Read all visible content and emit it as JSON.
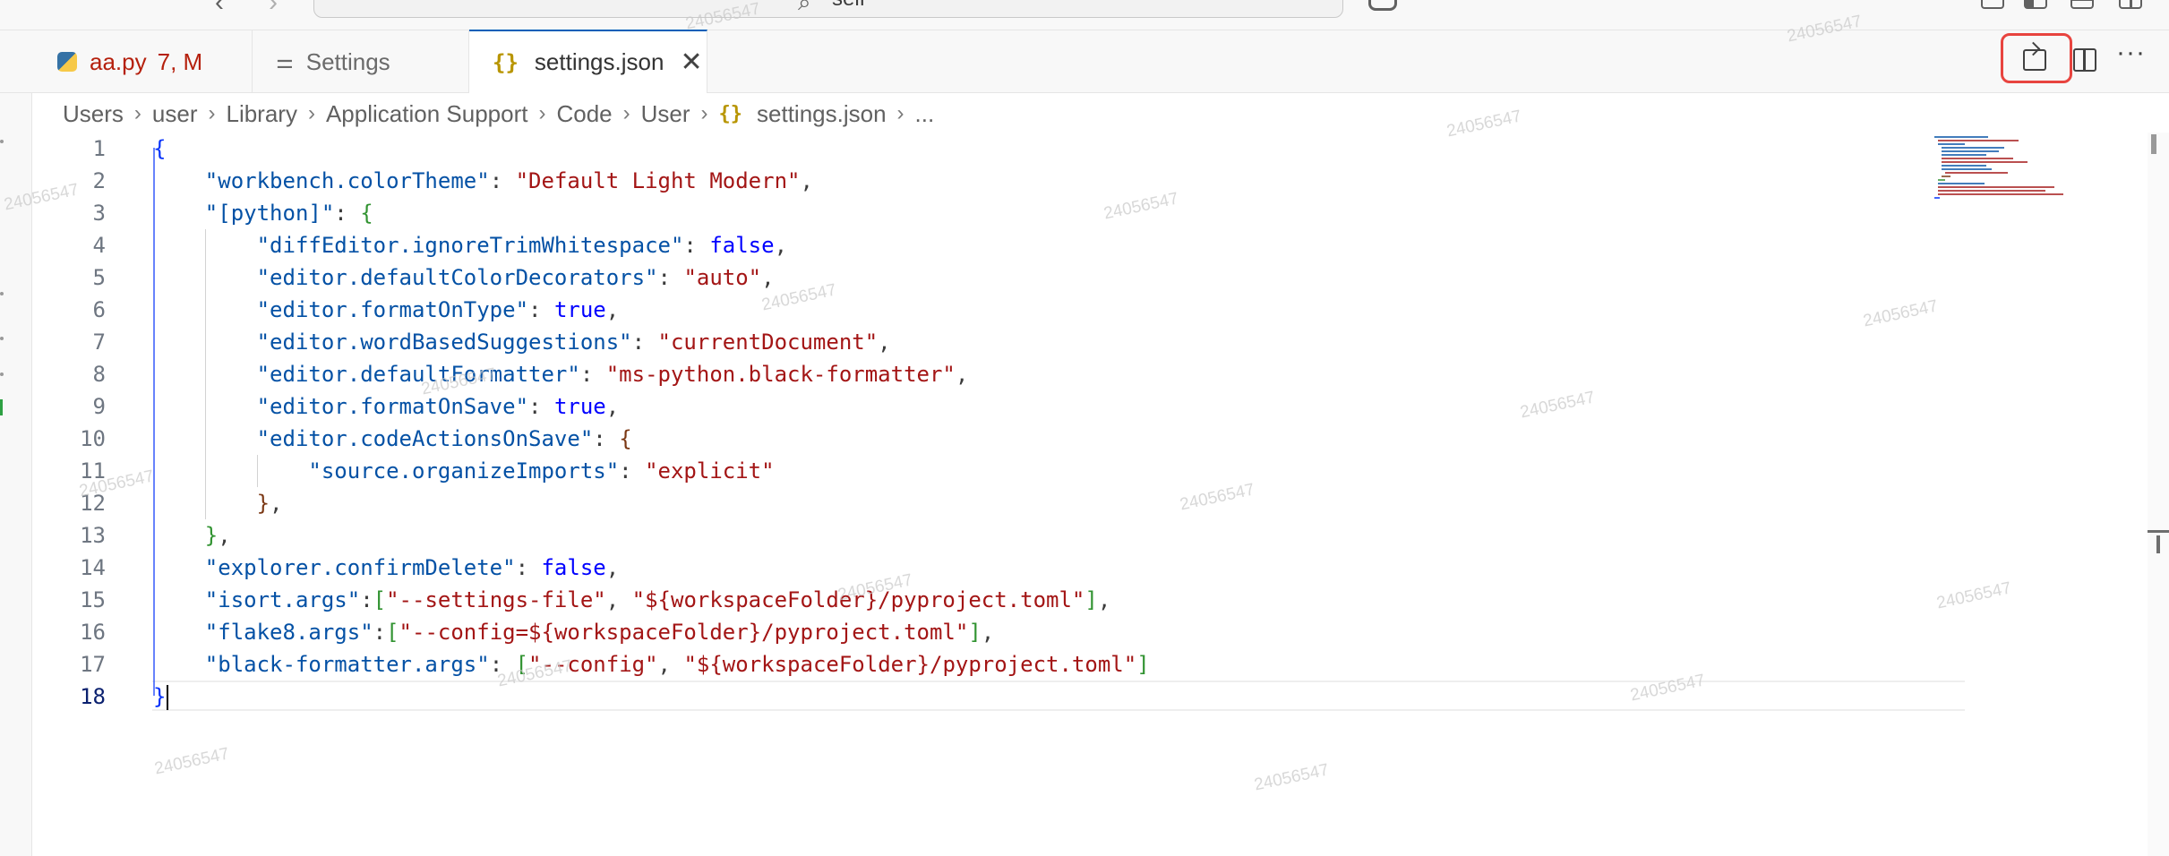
{
  "titlebar": {
    "search_text": "self"
  },
  "tabs": [
    {
      "name": "aa.py",
      "badge": "7, M"
    },
    {
      "name": "Settings"
    },
    {
      "name": "settings.json",
      "close": "✕"
    }
  ],
  "editor_actions": {
    "more": "···"
  },
  "breadcrumb": [
    "Users",
    "user",
    "Library",
    "Application Support",
    "Code",
    "User",
    "settings.json",
    "..."
  ],
  "editor": {
    "line_numbers": [
      "1",
      "2",
      "3",
      "4",
      "5",
      "6",
      "7",
      "8",
      "9",
      "10",
      "11",
      "12",
      "13",
      "14",
      "15",
      "16",
      "17",
      "18"
    ],
    "current_line": "18",
    "lines": [
      [
        [
          "br1",
          "{"
        ]
      ],
      [
        [
          "p",
          "    "
        ],
        [
          "k",
          "\"workbench.colorTheme\""
        ],
        [
          "p",
          ": "
        ],
        [
          "s",
          "\"Default Light Modern\""
        ],
        [
          "p",
          ","
        ]
      ],
      [
        [
          "p",
          "    "
        ],
        [
          "k",
          "\"[python]\""
        ],
        [
          "p",
          ": "
        ],
        [
          "br2",
          "{"
        ]
      ],
      [
        [
          "p",
          "        "
        ],
        [
          "k",
          "\"diffEditor.ignoreTrimWhitespace\""
        ],
        [
          "p",
          ": "
        ],
        [
          "b",
          "false"
        ],
        [
          "p",
          ","
        ]
      ],
      [
        [
          "p",
          "        "
        ],
        [
          "k",
          "\"editor.defaultColorDecorators\""
        ],
        [
          "p",
          ": "
        ],
        [
          "s",
          "\"auto\""
        ],
        [
          "p",
          ","
        ]
      ],
      [
        [
          "p",
          "        "
        ],
        [
          "k",
          "\"editor.formatOnType\""
        ],
        [
          "p",
          ": "
        ],
        [
          "b",
          "true"
        ],
        [
          "p",
          ","
        ]
      ],
      [
        [
          "p",
          "        "
        ],
        [
          "k",
          "\"editor.wordBasedSuggestions\""
        ],
        [
          "p",
          ": "
        ],
        [
          "s",
          "\"currentDocument\""
        ],
        [
          "p",
          ","
        ]
      ],
      [
        [
          "p",
          "        "
        ],
        [
          "k",
          "\"editor.defaultFormatter\""
        ],
        [
          "p",
          ": "
        ],
        [
          "s",
          "\"ms-python.black-formatter\""
        ],
        [
          "p",
          ","
        ]
      ],
      [
        [
          "p",
          "        "
        ],
        [
          "k",
          "\"editor.formatOnSave\""
        ],
        [
          "p",
          ": "
        ],
        [
          "b",
          "true"
        ],
        [
          "p",
          ","
        ]
      ],
      [
        [
          "p",
          "        "
        ],
        [
          "k",
          "\"editor.codeActionsOnSave\""
        ],
        [
          "p",
          ": "
        ],
        [
          "br3",
          "{"
        ]
      ],
      [
        [
          "p",
          "            "
        ],
        [
          "k",
          "\"source.organizeImports\""
        ],
        [
          "p",
          ": "
        ],
        [
          "s",
          "\"explicit\""
        ]
      ],
      [
        [
          "p",
          "        "
        ],
        [
          "br3",
          "}"
        ],
        [
          "p",
          ","
        ]
      ],
      [
        [
          "p",
          "    "
        ],
        [
          "br2",
          "}"
        ],
        [
          "p",
          ","
        ]
      ],
      [
        [
          "p",
          "    "
        ],
        [
          "k",
          "\"explorer.confirmDelete\""
        ],
        [
          "p",
          ": "
        ],
        [
          "b",
          "false"
        ],
        [
          "p",
          ","
        ]
      ],
      [
        [
          "p",
          "    "
        ],
        [
          "k",
          "\"isort.args\""
        ],
        [
          "p",
          ":"
        ],
        [
          "br2",
          "["
        ],
        [
          "s",
          "\"--settings-file\""
        ],
        [
          "p",
          ", "
        ],
        [
          "s",
          "\"${workspaceFolder}/pyproject.toml\""
        ],
        [
          "br2",
          "]"
        ],
        [
          "p",
          ","
        ]
      ],
      [
        [
          "p",
          "    "
        ],
        [
          "k",
          "\"flake8.args\""
        ],
        [
          "p",
          ":"
        ],
        [
          "br2",
          "["
        ],
        [
          "s",
          "\"--config=${workspaceFolder}/pyproject.toml\""
        ],
        [
          "br2",
          "]"
        ],
        [
          "p",
          ","
        ]
      ],
      [
        [
          "p",
          "    "
        ],
        [
          "k",
          "\"black-formatter.args\""
        ],
        [
          "p",
          ": "
        ],
        [
          "br2",
          "["
        ],
        [
          "s",
          "\"--config\""
        ],
        [
          "p",
          ", "
        ],
        [
          "s",
          "\"${workspaceFolder}/pyproject.toml\""
        ],
        [
          "br2",
          "]"
        ]
      ],
      [
        [
          "br1",
          "}"
        ]
      ]
    ]
  },
  "watermark": "24056547"
}
